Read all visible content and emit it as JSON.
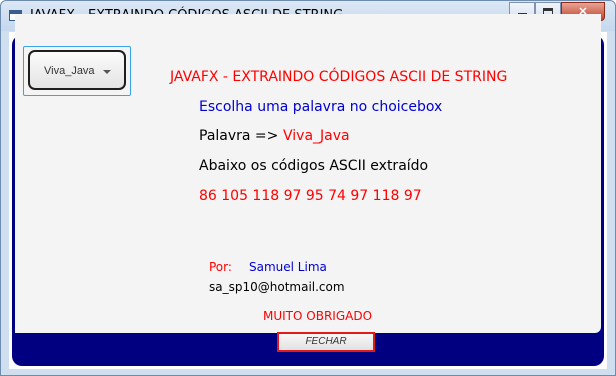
{
  "window": {
    "title": "JAVAFX - EXTRAINDO CÓDIGOS ASCII DE STRING",
    "controls": {
      "minimize": "minimize",
      "maximize": "maximize",
      "close": "✕"
    }
  },
  "choicebox": {
    "selected": "Viva_Java"
  },
  "content": {
    "heading": "JAVAFX - EXTRAINDO CÓDIGOS ASCII DE STRING",
    "instruction": "Escolha uma palavra no choicebox",
    "palavra_label": "Palavra =>",
    "palavra_value": "Viva_Java",
    "ascii_label": "Abaixo os códigos ASCII extraído",
    "ascii_codes": "86 105 118 97 95 74 97 118 97"
  },
  "credits": {
    "por_label": "Por:",
    "author": "Samuel Lima",
    "email": "sa_sp10@hotmail.com",
    "thanks": "MUITO OBRIGADO"
  },
  "buttons": {
    "close_label": "FECHAR"
  },
  "colors": {
    "frame": "#000080",
    "accent_red": "#ff0000",
    "accent_blue": "#0000d0",
    "focus": "#39a3e6"
  }
}
